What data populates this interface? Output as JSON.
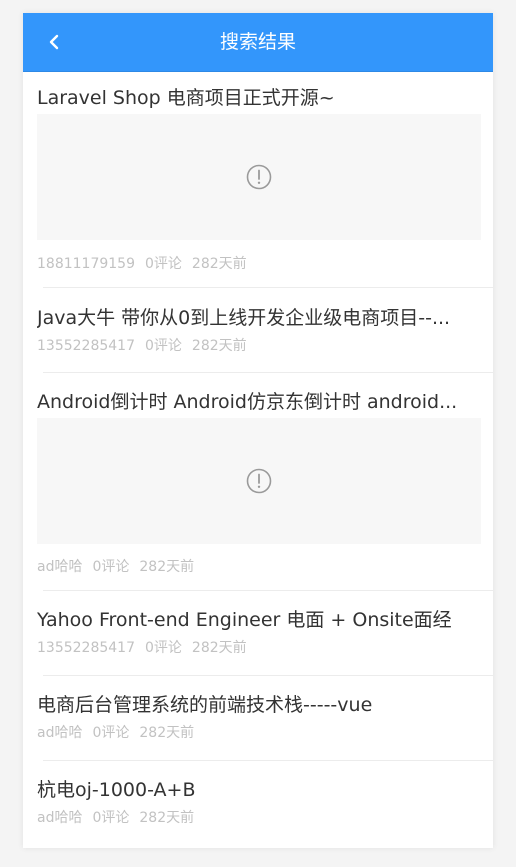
{
  "header": {
    "title": "搜索结果",
    "back_icon": "chevron-left-icon"
  },
  "colors": {
    "header_bg": "#3396fb",
    "title_text": "#333333",
    "meta_text": "#c2c2c2"
  },
  "items": [
    {
      "title": "Laravel Shop 电商项目正式开源~",
      "has_image": true,
      "image_icon": "alert-circle-icon",
      "author": "18811179159",
      "comments": "0评论",
      "time": "282天前"
    },
    {
      "title": "Java大牛 带你从0到上线开发企业级电商项目--...",
      "has_image": false,
      "author": "13552285417",
      "comments": "0评论",
      "time": "282天前"
    },
    {
      "title": "Android倒计时 Android仿京东倒计时 android...",
      "has_image": true,
      "image_icon": "alert-circle-icon",
      "author": "ad哈哈",
      "comments": "0评论",
      "time": "282天前"
    },
    {
      "title": "Yahoo Front-end Engineer 电面 + Onsite面经",
      "has_image": false,
      "author": "13552285417",
      "comments": "0评论",
      "time": "282天前"
    },
    {
      "title": "电商后台管理系统的前端技术栈-----vue",
      "has_image": false,
      "author": "ad哈哈",
      "comments": "0评论",
      "time": "282天前"
    },
    {
      "title": "杭电oj-1000-A+B",
      "has_image": false,
      "author": "ad哈哈",
      "comments": "0评论",
      "time": "282天前"
    }
  ]
}
